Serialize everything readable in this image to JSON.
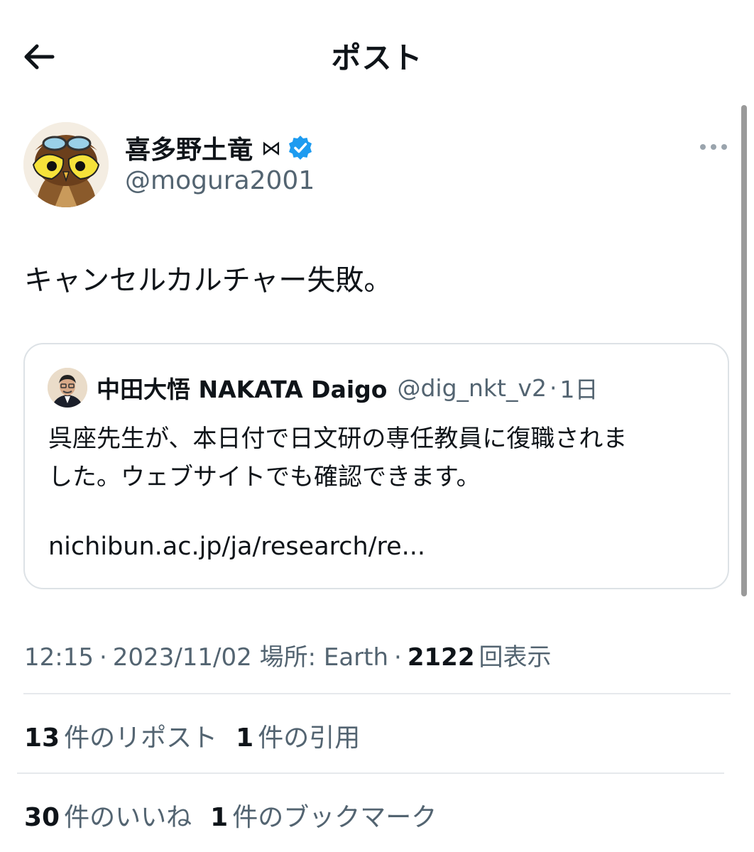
{
  "header": {
    "title": "ポスト"
  },
  "author": {
    "name": "喜多野土竜",
    "name_glyph": "⋈",
    "handle": "@mogura2001"
  },
  "tweet": {
    "text": "キャンセルカルチャー失敗。"
  },
  "quote": {
    "name": "中田大悟 NAKATA Daigo",
    "handle": "@dig_nkt_v2",
    "separator": "·",
    "time": "1日",
    "text_line1": "呉座先生が、本日付で日文研の専任教員に復職されま",
    "text_line2": "した。ウェブサイトでも確認できます。",
    "link": "nichibun.ac.jp/ja/research/re..."
  },
  "meta": {
    "time": "12:15",
    "sep1": "·",
    "date": "2023/11/02",
    "location_label": "場所: Earth",
    "sep2": "·",
    "views_count": "2122",
    "views_label": "回表示"
  },
  "stats": {
    "reposts_count": "13",
    "reposts_label": "件のリポスト",
    "quotes_count": "1",
    "quotes_label": "件の引用",
    "likes_count": "30",
    "likes_label": "件のいいね",
    "bookmarks_count": "1",
    "bookmarks_label": "件のブックマーク"
  },
  "colors": {
    "text_primary": "#0f1419",
    "text_secondary": "#536471",
    "verified_blue": "#1d9bf0",
    "border": "#dde2e6"
  },
  "icons": {
    "back": "arrow-left-icon",
    "verified": "verified-badge-icon",
    "more": "more-horizontal-icon"
  }
}
